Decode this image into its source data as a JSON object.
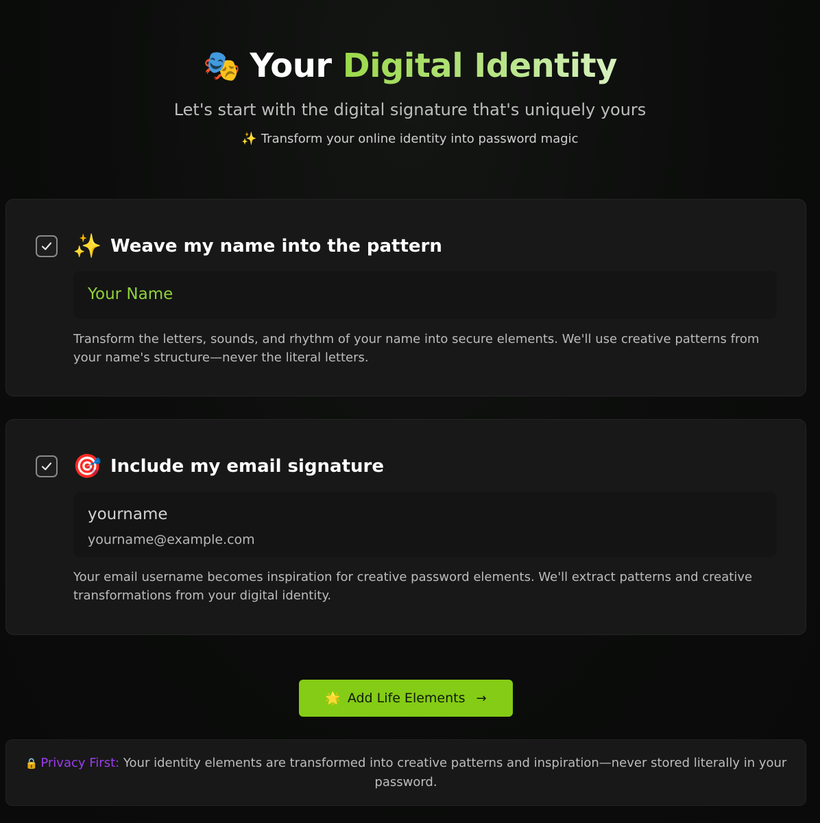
{
  "header": {
    "title_emoji": "🎭",
    "title_plain": "Your",
    "title_accent": "Digital Identity",
    "subtitle": "Let's start with the digital signature that's uniquely yours",
    "tagline_icon": "✨",
    "tagline": "Transform your online identity into password magic"
  },
  "cards": [
    {
      "checked": true,
      "emoji": "✨",
      "title": "Weave my name into the pattern",
      "field_value": "Your Name",
      "description": "Transform the letters, sounds, and rhythm of your name into secure elements. We'll use creative patterns from your name's structure—never the literal letters."
    },
    {
      "checked": true,
      "emoji": "🎯",
      "title": "Include my email signature",
      "field_value": "yourname",
      "field_sub": "yourname@example.com",
      "description": "Your email username becomes inspiration for creative password elements. We'll extract patterns and creative transformations from your digital identity."
    }
  ],
  "cta": {
    "icon": "🌟",
    "label": "Add Life Elements",
    "arrow": "→"
  },
  "privacy": {
    "icon": "🔒",
    "label": "Privacy First:",
    "text": " Your identity elements are transformed into creative patterns and inspiration—never stored literally in your password."
  },
  "colors": {
    "accent_green": "#84cc16",
    "privacy_purple": "#9b3cf0",
    "background": "#0b0c0b",
    "card": "#181818"
  }
}
